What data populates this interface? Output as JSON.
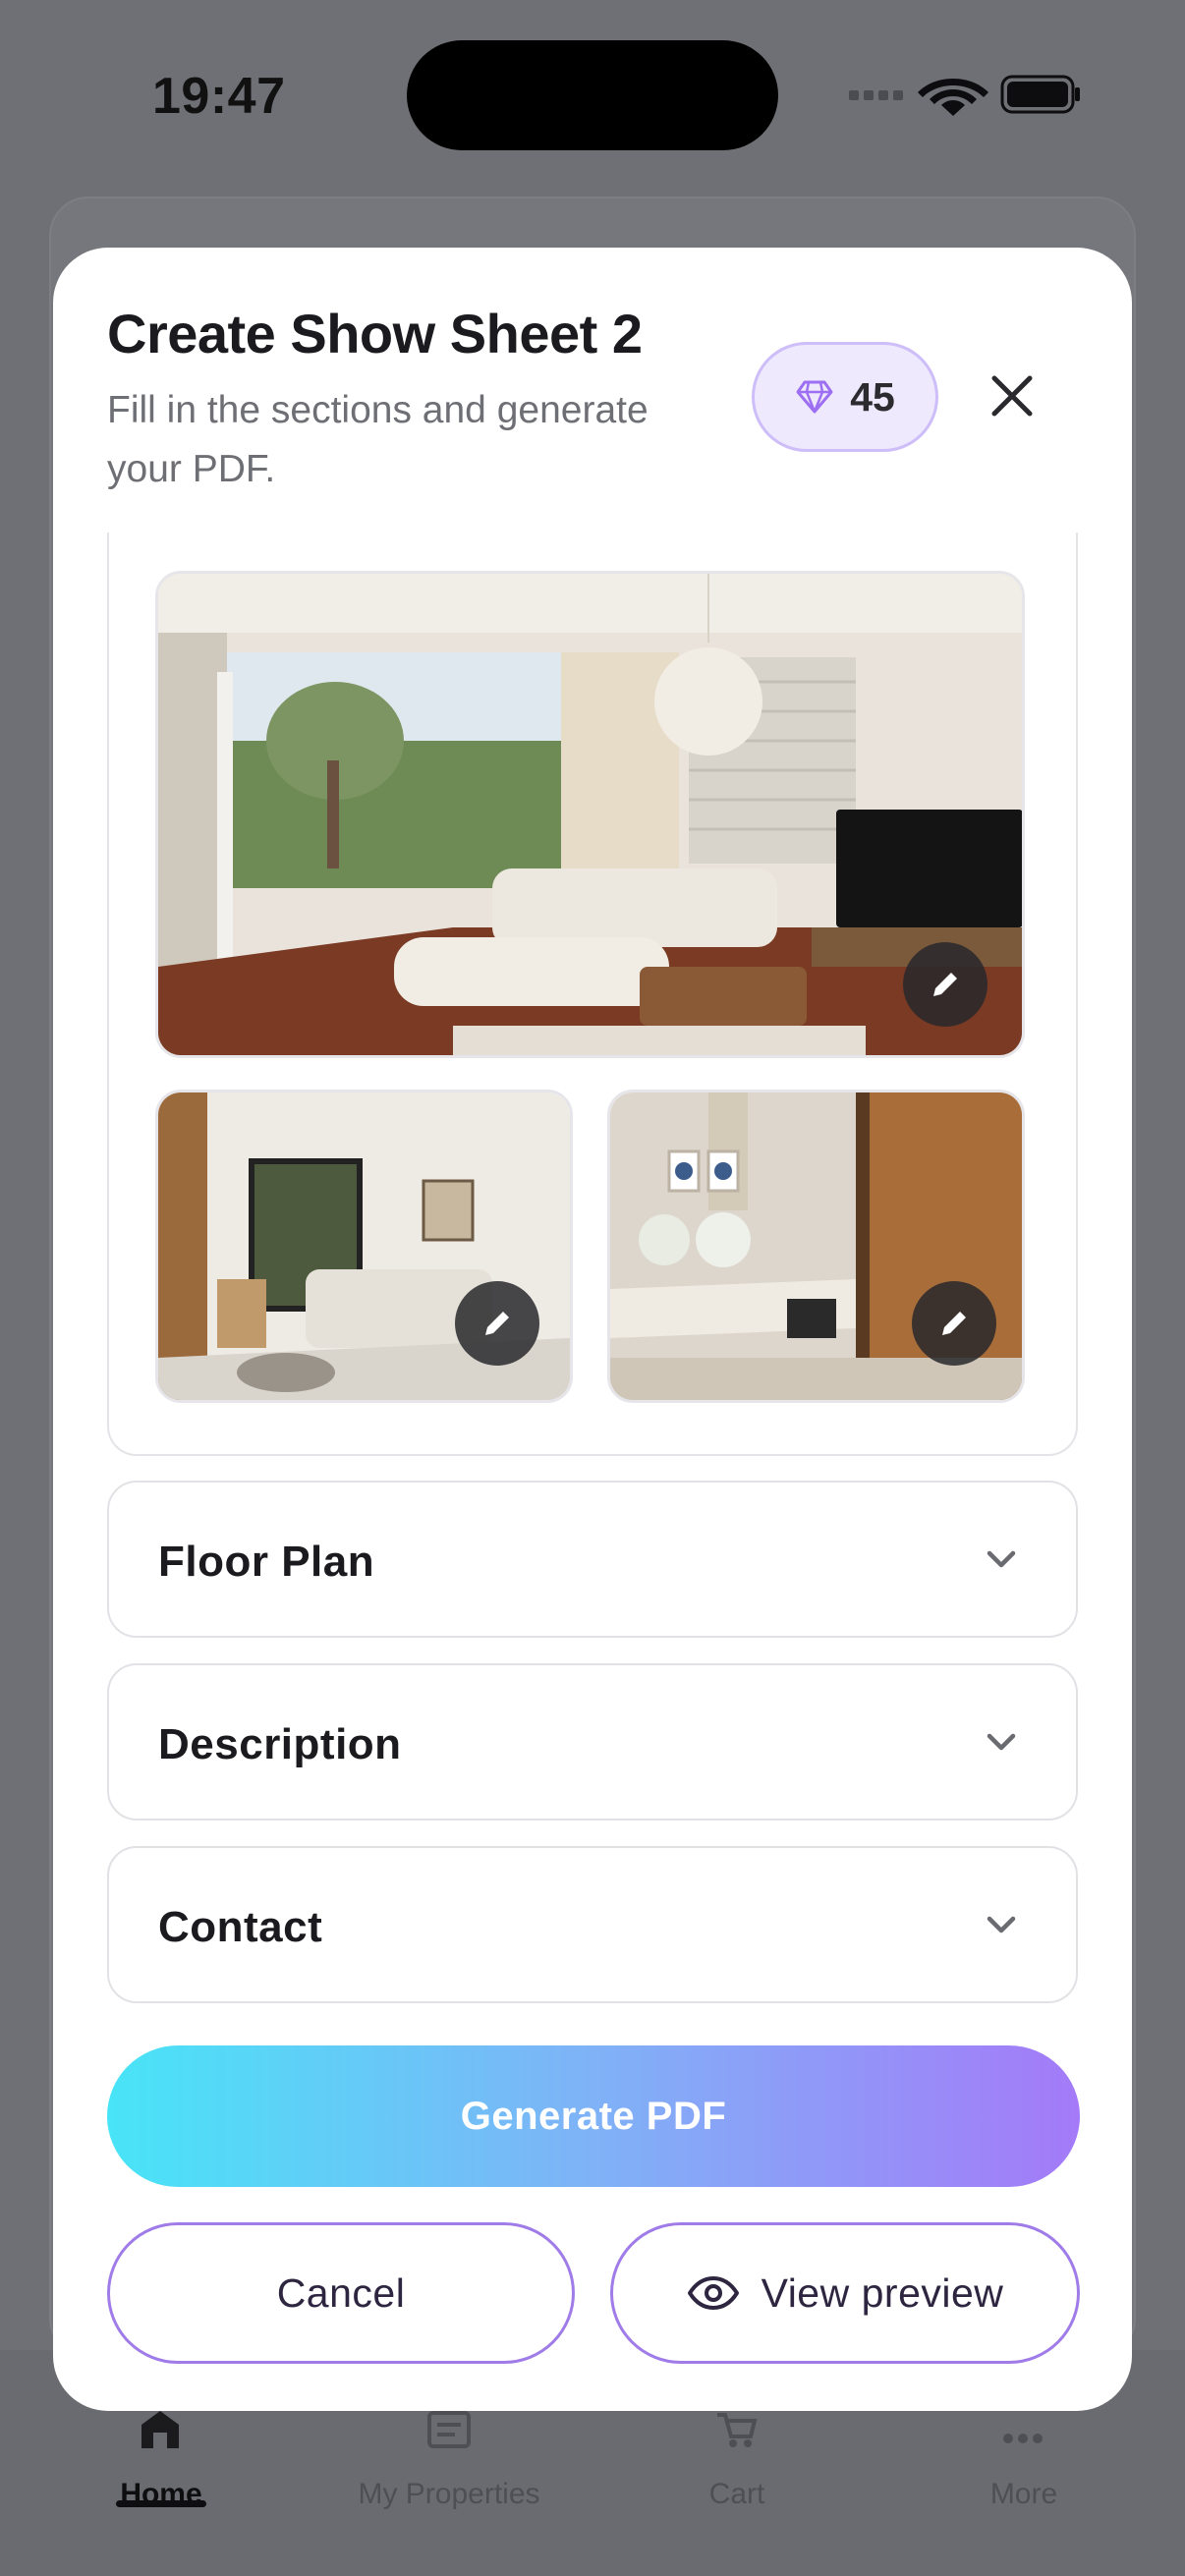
{
  "status_bar": {
    "time": "19:47",
    "icons": [
      "cellular-signal-icon",
      "wifi-icon",
      "battery-icon"
    ]
  },
  "background_app": {
    "tabs": [
      {
        "label": "Home",
        "icon": "home-icon",
        "active": true
      },
      {
        "label": "My Properties",
        "icon": "document-icon",
        "active": false
      },
      {
        "label": "Cart",
        "icon": "cart-icon",
        "active": false
      },
      {
        "label": "More",
        "icon": "more-icon",
        "active": false
      }
    ]
  },
  "modal": {
    "title": "Create Show Sheet 2",
    "subtitle": "Fill in the sections and generate your PDF.",
    "credits": {
      "icon": "diamond-icon",
      "count": "45"
    },
    "close_icon": "close-icon"
  },
  "photos": [
    {
      "name": "living-room-photo",
      "icon": "pencil-icon"
    },
    {
      "name": "lounge-photo",
      "icon": "pencil-icon"
    },
    {
      "name": "bathroom-photo",
      "icon": "pencil-icon"
    }
  ],
  "sections": [
    {
      "label": "Floor Plan",
      "icon": "chevron-down-icon"
    },
    {
      "label": "Description",
      "icon": "chevron-down-icon"
    },
    {
      "label": "Contact",
      "icon": "chevron-down-icon"
    }
  ],
  "actions": {
    "generate_label": "Generate PDF",
    "cancel_label": "Cancel",
    "preview_label": "View preview",
    "preview_icon": "eye-icon"
  },
  "colors": {
    "accent_purple": "#a07ce8",
    "gradient_start": "#48e4f7",
    "gradient_end": "#a47af8",
    "credit_badge_bg": "#efe9fe"
  }
}
